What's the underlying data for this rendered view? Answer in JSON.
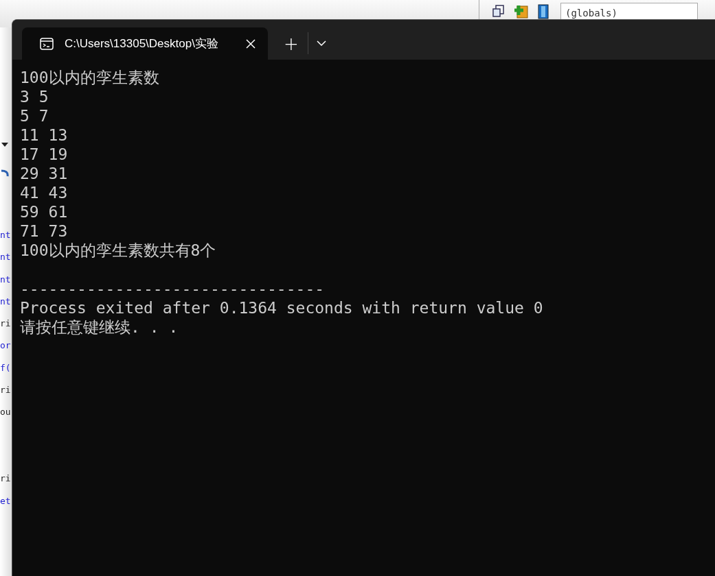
{
  "background_editor": {
    "toolbar_dropdown": "(globals)",
    "code_fragments": [
      "nt",
      "nt",
      "nt",
      "nt",
      "ri",
      "or",
      "f(",
      "ri",
      "ou",
      "ri",
      "et"
    ]
  },
  "terminal": {
    "tab": {
      "title": "C:\\Users\\13305\\Desktop\\实验",
      "selected": true
    },
    "new_tab": "+",
    "output": [
      "100以内的孪生素数",
      "3 5",
      "5 7",
      "11 13",
      "17 19",
      "29 31",
      "41 43",
      "59 61",
      "71 73",
      "100以内的孪生素数共有8个"
    ],
    "footer": [
      "--------------------------------",
      "Process exited after 0.1364 seconds with return value 0",
      "请按任意键继续. . ."
    ]
  }
}
